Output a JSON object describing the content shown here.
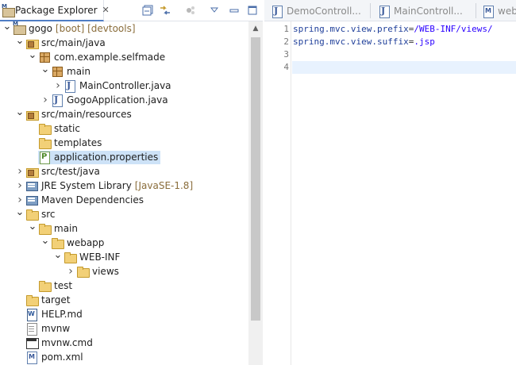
{
  "left_panel": {
    "tab_title": "Package Explorer",
    "tab_close": "✕",
    "toolbar": {
      "collapse_all_icon": "collapse-all-icon",
      "link_with_editor_icon": "link-with-editor-icon",
      "focus_icon": "focus-on-active-task-icon",
      "view_menu_icon": "view-menu-icon",
      "minimize_icon": "minimize-icon",
      "maximize_icon": "maximize-icon"
    },
    "tree": [
      {
        "label": "gogo",
        "decoration": "[boot] [devtools]",
        "icon": "project",
        "arrow": "open",
        "indent": 0
      },
      {
        "label": "src/main/java",
        "icon": "srcfolder",
        "arrow": "open",
        "indent": 1
      },
      {
        "label": "com.example.selfmade",
        "icon": "package",
        "arrow": "open",
        "indent": 2
      },
      {
        "label": "main",
        "icon": "package",
        "arrow": "open",
        "indent": 3
      },
      {
        "label": "MainController.java",
        "icon": "java",
        "arrow": "closed",
        "indent": 4
      },
      {
        "label": "GogoApplication.java",
        "icon": "java",
        "arrow": "closed",
        "indent": 3
      },
      {
        "label": "src/main/resources",
        "icon": "srcfolder",
        "arrow": "open",
        "indent": 1
      },
      {
        "label": "static",
        "icon": "folder",
        "arrow": "none",
        "indent": 2
      },
      {
        "label": "templates",
        "icon": "folder",
        "arrow": "none",
        "indent": 2
      },
      {
        "label": "application.properties",
        "icon": "properties",
        "arrow": "none",
        "indent": 2,
        "selected": true
      },
      {
        "label": "src/test/java",
        "icon": "srcfolder",
        "arrow": "closed",
        "indent": 1
      },
      {
        "label": "JRE System Library",
        "decoration": "[JavaSE-1.8]",
        "icon": "library",
        "arrow": "closed",
        "indent": 1
      },
      {
        "label": "Maven Dependencies",
        "icon": "library",
        "arrow": "closed",
        "indent": 1
      },
      {
        "label": "src",
        "icon": "folder",
        "arrow": "open",
        "indent": 1
      },
      {
        "label": "main",
        "icon": "folder",
        "arrow": "open",
        "indent": 2
      },
      {
        "label": "webapp",
        "icon": "folder",
        "arrow": "open",
        "indent": 3
      },
      {
        "label": "WEB-INF",
        "icon": "folder",
        "arrow": "open",
        "indent": 4
      },
      {
        "label": "views",
        "icon": "folder",
        "arrow": "closed",
        "indent": 5
      },
      {
        "label": "test",
        "icon": "folder",
        "arrow": "none",
        "indent": 2
      },
      {
        "label": "target",
        "icon": "folder",
        "arrow": "none",
        "indent": 1
      },
      {
        "label": "HELP.md",
        "icon": "md",
        "arrow": "none",
        "indent": 1
      },
      {
        "label": "mvnw",
        "icon": "file",
        "arrow": "none",
        "indent": 1
      },
      {
        "label": "mvnw.cmd",
        "icon": "cmd",
        "arrow": "none",
        "indent": 1
      },
      {
        "label": "pom.xml",
        "icon": "xml",
        "arrow": "none",
        "indent": 1
      }
    ]
  },
  "editor": {
    "tabs": [
      {
        "label": "DemoControll...",
        "icon": "java"
      },
      {
        "label": "MainControll...",
        "icon": "java"
      },
      {
        "label": "webs",
        "icon": "xml"
      }
    ],
    "line_numbers": [
      "1",
      "2",
      "3",
      "4"
    ],
    "lines": [
      {
        "key": "spring.mvc.view.prefix",
        "eq": "=",
        "value": "/WEB-INF/views/"
      },
      {
        "key": "spring.mvc.view.suffix",
        "eq": "=",
        "value": ".jsp"
      },
      {
        "key": "",
        "eq": "",
        "value": ""
      },
      {
        "key": "",
        "eq": "",
        "value": ""
      }
    ],
    "current_line": 4
  },
  "colors": {
    "selection": "#cde2f7",
    "current_line": "#e8f2fe",
    "decoration": "#8a6d3b",
    "property_key": "#1f3f9a",
    "property_value": "#2a00ff"
  }
}
